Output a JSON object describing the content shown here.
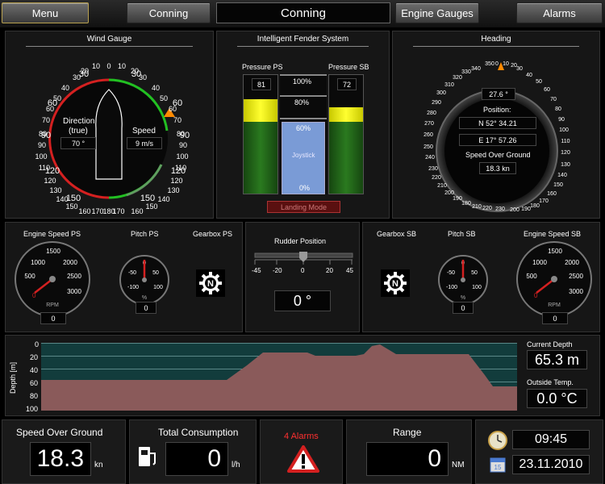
{
  "toolbar": {
    "menu_label": "Menu",
    "conning_label": "Conning",
    "title": "Conning",
    "engine_gauges_label": "Engine Gauges",
    "alarms_label": "Alarms"
  },
  "wind": {
    "title": "Wind Gauge",
    "direction_label": "Direction",
    "direction_sub": "(true)",
    "direction_value": "70 °",
    "speed_label": "Speed",
    "speed_value": "9 m/s"
  },
  "fender": {
    "title": "Intelligent Fender System",
    "pressure_ps_label": "Pressure PS",
    "pressure_sb_label": "Pressure SB",
    "pressure_ps_value": "81",
    "pressure_sb_value": "72",
    "level_100": "100%",
    "level_80": "80%",
    "level_60": "60%",
    "level_0": "0%",
    "joystick_label": "Joystick",
    "landing_mode_label": "Landing Mode"
  },
  "heading": {
    "title": "Heading",
    "heading_value": "27.6 °",
    "position_label": "Position:",
    "lat_value": "N 52° 34.21",
    "lon_value": "E 17° 57.26",
    "sog_label": "Speed Over Ground",
    "sog_value": "18.3 kn"
  },
  "engine_ps": {
    "engine_speed_label": "Engine Speed PS",
    "pitch_label": "Pitch PS",
    "gearbox_label": "Gearbox PS",
    "rpm_unit": "RPM",
    "rpm_value": "0",
    "pitch_unit": "%",
    "pitch_value": "0",
    "gear": "N"
  },
  "rudder": {
    "title": "Rudder Position",
    "value": "0 °",
    "ticks": [
      "-45",
      "-20",
      "0",
      "20",
      "45"
    ]
  },
  "engine_sb": {
    "engine_speed_label": "Engine Speed SB",
    "pitch_label": "Pitch SB",
    "gearbox_label": "Gearbox SB",
    "rpm_unit": "RPM",
    "rpm_value": "0",
    "pitch_unit": "%",
    "pitch_value": "0",
    "gear": "N"
  },
  "depth": {
    "axis_label": "Depth [m]",
    "ticks": [
      "0",
      "20",
      "40",
      "60",
      "80",
      "100"
    ],
    "current_depth_label": "Current Depth",
    "current_depth_value": "65.3 m",
    "outside_temp_label": "Outside Temp.",
    "outside_temp_value": "0.0 °C"
  },
  "bottom": {
    "sog_label": "Speed Over Ground",
    "sog_value": "18.3",
    "sog_unit": "kn",
    "consumption_label": "Total Consumption",
    "consumption_value": "0",
    "consumption_unit": "l/h",
    "alarms_label": "4 Alarms",
    "range_label": "Range",
    "range_value": "0",
    "range_unit": "NM",
    "time": "09:45",
    "date": "23.11.2010",
    "calendar_day": "15"
  },
  "colors": {
    "accent_green": "#22c022",
    "accent_red": "#d42020",
    "fender_yellow": "#e0e000",
    "fender_green": "#1f5f16",
    "joystick_blue": "#7a9bd6",
    "depth_water": "#123c3c",
    "depth_ground": "#8a5a5a",
    "alarm_red": "#ff3030"
  },
  "icons": {
    "gearbox_icon": "gear-icon",
    "clock_icon": "clock-icon",
    "calendar_icon": "calendar-icon",
    "fuel_icon": "fuel-pump-icon",
    "alarm_icon": "warning-icon"
  }
}
